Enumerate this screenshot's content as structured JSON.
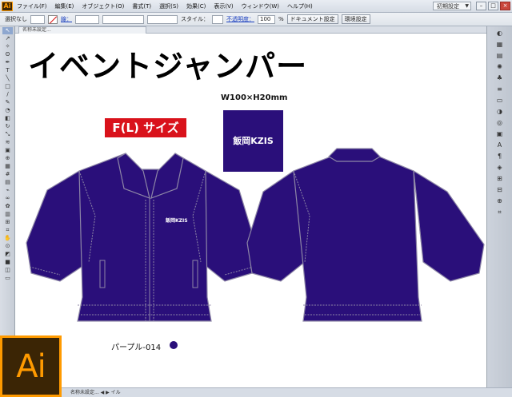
{
  "app": {
    "badge": "Ai"
  },
  "menubar": {
    "items": [
      "ファイル(F)",
      "編集(E)",
      "オブジェクト(O)",
      "書式(T)",
      "選択(S)",
      "効果(C)",
      "表示(V)",
      "ウィンドウ(W)",
      "ヘルプ(H)"
    ],
    "workspace": "初期設定",
    "window_buttons": [
      "–",
      "□",
      "×"
    ]
  },
  "controlbar": {
    "selection_label": "選択なし",
    "stroke_label": "線：",
    "style_label": "スタイル：",
    "opacity_label": "不透明度：",
    "opacity_value": "100",
    "opacity_unit": "%",
    "doc_settings": "ドキュメント設定",
    "preferences": "環境設定"
  },
  "document_tab": {
    "label": "名称未設定..."
  },
  "artwork": {
    "title": "イベントジャンパー",
    "size_badge": "F(L) サイズ",
    "dimensions": "W100×H20mm",
    "logo_text": "飯岡KZIS",
    "chest_logo": "飯岡KZIS",
    "color_label": "パープル-014",
    "jacket_color": "#2a0f7a",
    "stitch_color": "#8d86a6"
  },
  "statusbar": {
    "text": "名称未設定...  ◀ ▶  イル"
  },
  "logo": {
    "text": "Ai"
  }
}
